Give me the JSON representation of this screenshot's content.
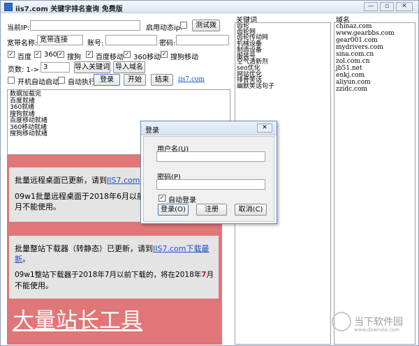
{
  "window": {
    "title": "iis7.com 关键字排名查询 免费版",
    "minimize_glyph": "—",
    "restore_glyph": "▫",
    "close_glyph": "✕"
  },
  "top": {
    "current_ip_label": "当前IP:",
    "current_ip_value": "",
    "enable_dynamic_ip_label": "启用动态ip:",
    "test_dialup_button": "测试拨",
    "broadband_name_label": "宽带名称:",
    "broadband_name_value": "宽带连接",
    "account_label": "账号:",
    "account_value": "",
    "password_label": "密码:",
    "password_value": ""
  },
  "engines": [
    {
      "label": "百度",
      "checked": true
    },
    {
      "label": "360",
      "checked": true
    },
    {
      "label": "搜狗",
      "checked": true
    },
    {
      "label": "百度移动",
      "checked": true
    },
    {
      "label": "360移动",
      "checked": true
    },
    {
      "label": "搜狗移动",
      "checked": true
    }
  ],
  "controls": {
    "pages_label": "页数: 1->",
    "pages_value": "3",
    "import_keywords_button": "导入关键词",
    "import_domains_button": "导入域名",
    "auto_start_label": "开机自动启动",
    "auto_start_checked": false,
    "auto_run_label": "自动执行",
    "auto_run_checked": false,
    "login_button": "登录",
    "start_button": "开始",
    "stop_button": "结束",
    "site_link": "iis7.com"
  },
  "status_lines": [
    "数据加载完",
    "百度就绪",
    "360就绪",
    "搜狗就绪",
    "百度移动就绪",
    "360移动就绪",
    "搜狗移动就绪"
  ],
  "ad": {
    "box1_line1_prefix": "批量远程桌面已更新，请到",
    "box1_line1_link": "IIS7.com",
    "box1_line2": "09w1批量远程桌面于2018年6月以前下",
    "box1_line3": "月不能使用。",
    "box2_line1_prefix": "批量整站下载器（转静态）已更新，请到",
    "box2_line1_link": "IIS7.com下载最",
    "box2_line2_link": "新",
    "box2_line2_suffix": "。",
    "box2_line3_a": "09w1整站下载器于2018年7月以前下载的，将在2018年",
    "box2_line3_highlight": "7",
    "box2_line3_b": "月",
    "box2_line4": "不能使用。",
    "big_slogan": "大量站长工具",
    "accent_color": "#e07677"
  },
  "keywords_panel": {
    "title": "关键词",
    "items": [
      "齿轮",
      "齿轮网",
      "齿轮传动网",
      "机械设备",
      "制造设备",
      "服装号",
      "空气清新剂",
      "seo优化",
      "网站优化",
      "排骨笑话",
      "幽默笑话句子"
    ]
  },
  "domains_panel": {
    "title": "域名",
    "items": [
      "chinaz.com",
      "www.gearbbs.com",
      "gear001.com",
      "mydrivers.com",
      "sina.com.cn",
      "zol.com.cn",
      "jb51.net",
      "enkj.com",
      "aliyun.com",
      "zzidc.com"
    ]
  },
  "login_dialog": {
    "title": "登录",
    "close_glyph": "✕",
    "username_label": "用户名(U)",
    "username_value": "",
    "password_label": "密码(P)",
    "password_value": "",
    "auto_login_label": "自动登录",
    "auto_login_checked": true,
    "login_button": "登录(O)",
    "register_button": "注册",
    "cancel_button": "取消(C)"
  },
  "watermark": {
    "text": "当下软件园",
    "sub": "www.downxia.com"
  }
}
